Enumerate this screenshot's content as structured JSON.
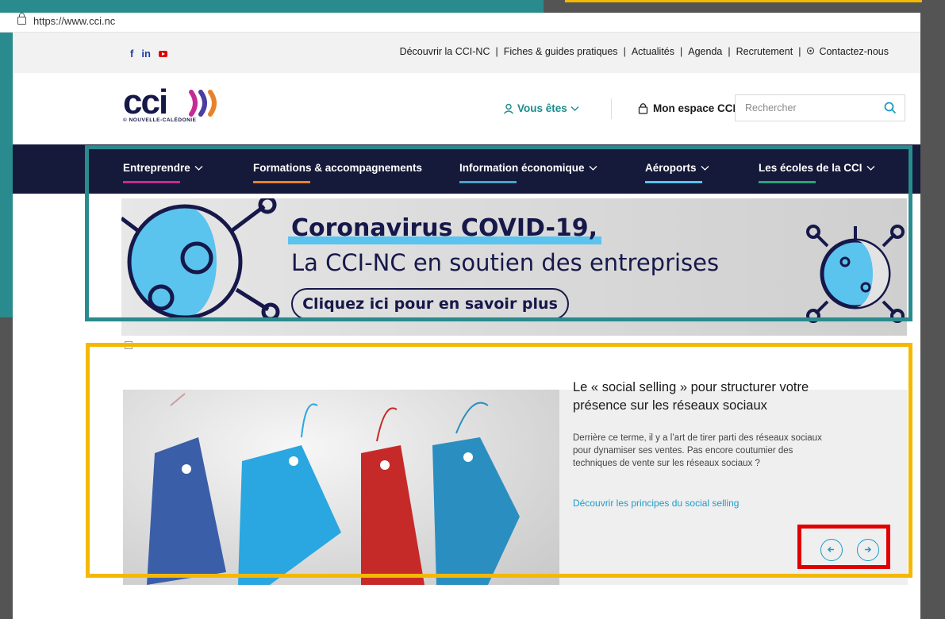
{
  "browser": {
    "url": "https://www.cci.nc"
  },
  "topbar": {
    "social": [
      {
        "label": "f",
        "icon": "facebook-icon"
      },
      {
        "label": "in",
        "icon": "linkedin-icon"
      },
      {
        "label": "",
        "icon": "youtube-icon"
      }
    ],
    "links": [
      "Découvrir la CCI-NC",
      "Fiches & guides pratiques",
      "Actualités",
      "Agenda",
      "Recrutement",
      "Contactez-nous"
    ]
  },
  "header": {
    "logo_word": "cci",
    "logo_sub": "© NOUVELLE-CALÉDONIE",
    "vous_etes": "Vous êtes",
    "mon_espace": "Mon espace CCI",
    "search_placeholder": "Rechercher"
  },
  "nav": {
    "items": [
      "Entreprendre",
      "Formations & accompagnements",
      "Information économique",
      "Aéroports",
      "Les écoles de la CCI"
    ],
    "colors": [
      "#c62a94",
      "#e8822a",
      "#4aa3c7",
      "#59c1ee",
      "#2aa37a"
    ]
  },
  "banner": {
    "line1": "Coronavirus COVID-19,",
    "line2": "La CCI-NC en soutien des entreprises",
    "cta": "Cliquez ici pour en savoir plus"
  },
  "promo": {
    "title": "Le « social selling » pour structurer votre présence sur les réseaux sociaux",
    "description": "Derrière ce terme, il y a l’art de tirer parti des réseaux sociaux pour dynamiser ses ventes. Pas encore coutumier des techniques de vente sur les réseaux sociaux ?",
    "link": "Découvrir les principes du social selling"
  },
  "colors": {
    "teal": "#2a8b8e",
    "yellow": "#f5b800",
    "red": "#e00000",
    "navy": "#15193a"
  }
}
